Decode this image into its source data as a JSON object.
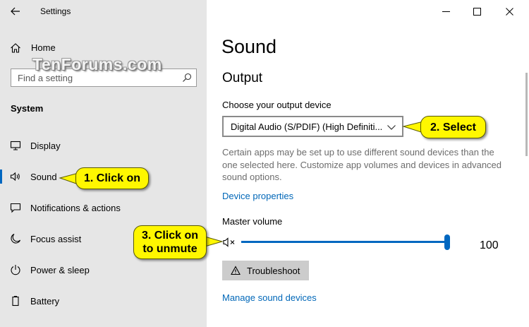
{
  "window": {
    "title": "Settings",
    "controls": [
      "minimize-icon",
      "maximize-icon",
      "close-icon"
    ]
  },
  "sidebar": {
    "home_label": "Home",
    "search_placeholder": "Find a setting",
    "watermark": "TenForums.com",
    "section": "System",
    "items": [
      {
        "label": "Display",
        "icon": "monitor-icon",
        "selected": false
      },
      {
        "label": "Sound",
        "icon": "speaker-icon",
        "selected": true
      },
      {
        "label": "Notifications & actions",
        "icon": "notification-icon",
        "selected": false
      },
      {
        "label": "Focus assist",
        "icon": "moon-icon",
        "selected": false
      },
      {
        "label": "Power & sleep",
        "icon": "power-icon",
        "selected": false
      },
      {
        "label": "Battery",
        "icon": "battery-icon",
        "selected": false
      }
    ]
  },
  "main": {
    "title": "Sound",
    "output": {
      "heading": "Output",
      "device_label": "Choose your output device",
      "device_value": "Digital Audio (S/PDIF) (High Definiti...",
      "description": "Certain apps may be set up to use different sound devices than the one selected here. Customize app volumes and devices in advanced sound options.",
      "device_properties_link": "Device properties",
      "master_volume_label": "Master volume",
      "volume": 100,
      "muted": true,
      "troubleshoot_label": "Troubleshoot",
      "manage_link": "Manage sound devices"
    }
  },
  "callouts": {
    "click_on": "1. Click on",
    "select": "2. Select",
    "unmute_line1": "3. Click on",
    "unmute_line2": "to unmute"
  },
  "colors": {
    "accent": "#0067c0",
    "link": "#0067b8",
    "sidebar_bg": "#e6e6e6",
    "callout_bg": "#fff700"
  }
}
